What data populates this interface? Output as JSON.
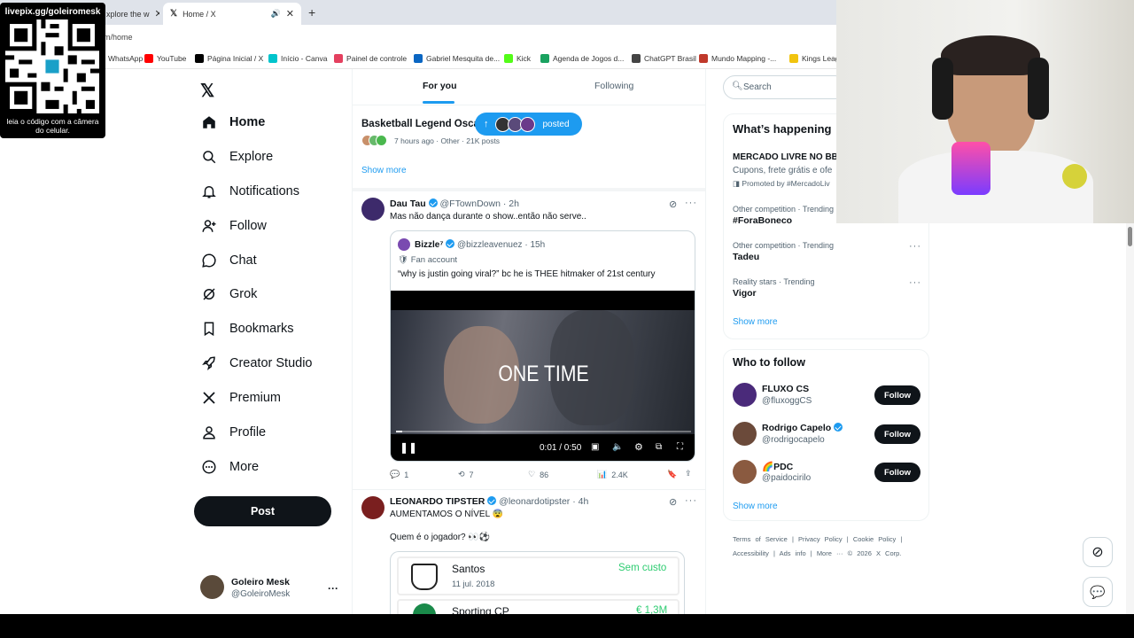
{
  "browser": {
    "tabs": [
      {
        "label": "xplore the w"
      },
      {
        "label": "Home / X"
      }
    ],
    "new_tab": "+",
    "url": "m/home",
    "bookmarks": [
      {
        "label": "WhatsApp",
        "color": "#25d366"
      },
      {
        "label": "YouTube",
        "color": "#ff0000"
      },
      {
        "label": "Página Inicial / X",
        "color": "#000000"
      },
      {
        "label": "Início - Canva",
        "color": "#00c4cc"
      },
      {
        "label": "Painel de controle",
        "color": "#e4405f"
      },
      {
        "label": "Gabriel Mesquita de...",
        "color": "#0a66c2"
      },
      {
        "label": "Kick",
        "color": "#53fc18"
      },
      {
        "label": "Agenda de Jogos d...",
        "color": "#1aa260"
      },
      {
        "label": "ChatGPT Brasil",
        "color": "#444444"
      },
      {
        "label": "Mundo Mapping -...",
        "color": "#c0392b"
      },
      {
        "label": "Kings Leag",
        "color": "#f1c40f"
      }
    ]
  },
  "overlay": {
    "qr_caption_top": "livepix.gg/goleiromesk",
    "qr_caption_bottom": "leia o código com a câmera do celular."
  },
  "nav": {
    "items": [
      {
        "label": "Home",
        "icon": "home-icon"
      },
      {
        "label": "Explore",
        "icon": "search-icon"
      },
      {
        "label": "Notifications",
        "icon": "bell-icon"
      },
      {
        "label": "Follow",
        "icon": "follow-icon"
      },
      {
        "label": "Chat",
        "icon": "chat-icon"
      },
      {
        "label": "Grok",
        "icon": "grok-icon"
      },
      {
        "label": "Bookmarks",
        "icon": "bookmark-icon"
      },
      {
        "label": "Creator Studio",
        "icon": "rocket-icon"
      },
      {
        "label": "Premium",
        "icon": "x-icon"
      },
      {
        "label": "Profile",
        "icon": "person-icon"
      },
      {
        "label": "More",
        "icon": "more-icon"
      }
    ],
    "post": "Post",
    "account": {
      "name": "Goleiro Mesk",
      "handle": "@GoleiroMesk",
      "menu": "···"
    }
  },
  "feed": {
    "tabs": {
      "for_you": "For you",
      "following": "Following"
    },
    "new_posts": "posted",
    "trend_card": {
      "title": "Basketball Legend Osca",
      "meta": "7 hours ago · Other · 21K posts",
      "show_more": "Show more"
    },
    "tweet1": {
      "name": "Dau Tau",
      "handle": "@FTownDown",
      "time": "· 2h",
      "text": "Mas não dança durante o show..então não serve..",
      "quote": {
        "name": "Bizzle⁷",
        "handle": "@bizzleavenuez",
        "time": "· 15h",
        "label": "Fan account",
        "text": "“why is justin going viral?” bc he is THEE hitmaker of 21st century"
      },
      "video": {
        "overlay_text": "ONE TIME",
        "time": "0:01 / 0:50",
        "progress": 0.02
      },
      "stats": {
        "replies": "1",
        "reposts": "7",
        "likes": "86",
        "views": "2.4K"
      }
    },
    "tweet2": {
      "name": "LEONARDO TIPSTER",
      "handle": "@leonardotipster",
      "time": "· 4h",
      "text1": "AUMENTAMOS O NÍVEL 😨",
      "text2": "Quem é o jogador? 👀⚽",
      "card": [
        {
          "club": "Santos",
          "date": "11 jul. 2018",
          "fee": "Sem custo",
          "fee_color": "#2ecc71"
        },
        {
          "club": "Sporting CP",
          "date": "",
          "fee": "€ 1,3M",
          "fee_color": "#2ecc71"
        }
      ]
    }
  },
  "right": {
    "search_placeholder": "Search",
    "happening": {
      "title": "What’s happening",
      "promo": {
        "title": "MERCADO LIVRE NO BB",
        "desc": "Cupons, frete grátis e ofe",
        "promoted": "Promoted by #MercadoLiv"
      },
      "trends": [
        {
          "meta": "Other competition · Trending",
          "name": "#ForaBoneco"
        },
        {
          "meta": "Other competition · Trending",
          "name": "Tadeu"
        },
        {
          "meta": "Reality stars · Trending",
          "name": "Vigor"
        }
      ],
      "show_more": "Show more"
    },
    "who": {
      "title": "Who to follow",
      "people": [
        {
          "name": "FLUXO CS",
          "handle": "@fluxoggCS",
          "verified": false,
          "avatar": "#4a2a7a"
        },
        {
          "name": "Rodrigo Capelo",
          "handle": "@rodrigocapelo",
          "verified": true,
          "avatar": "#6b4a3a"
        },
        {
          "name": "🌈PDC",
          "handle": "@paidocirilo",
          "verified": false,
          "avatar": "#8a5a40"
        }
      ],
      "follow_label": "Follow",
      "show_more": "Show more"
    },
    "footer": {
      "l1": [
        "Terms of Service",
        "|",
        "Privacy Policy",
        "|",
        "Cookie Policy",
        "|"
      ],
      "l2": [
        "Accessibility",
        "|",
        "Ads info",
        "|",
        "More ···",
        "© 2026 X Corp."
      ]
    }
  }
}
